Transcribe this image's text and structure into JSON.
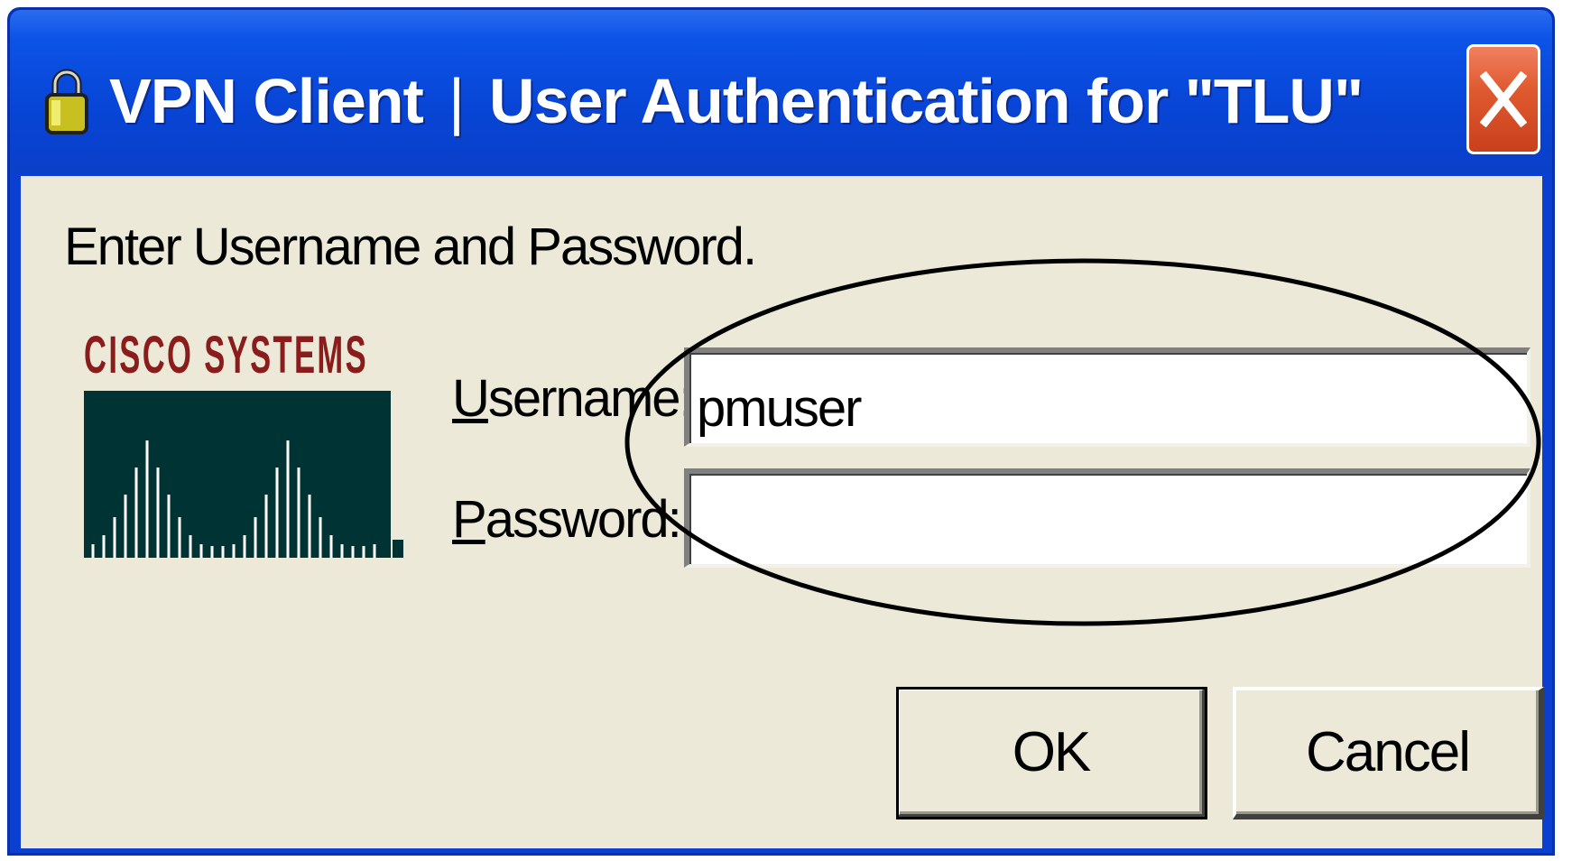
{
  "window": {
    "app_name": "VPN Client",
    "separator": "|",
    "dialog_title": "User Authentication for \"TLU\"",
    "close_symbol": "×"
  },
  "dialog": {
    "prompt": "Enter Username and Password.",
    "logo_text": "Cisco Systems",
    "username": {
      "label_accel": "U",
      "label_rest": "sername:",
      "value": "pmuser"
    },
    "password": {
      "label_accel": "P",
      "label_rest": "assword:",
      "value": ""
    },
    "ok_label": "OK",
    "cancel_label": "Cancel"
  },
  "colors": {
    "titlebar": "#0a47d8",
    "client_bg": "#ece9d8",
    "logo_red": "#8a1c1c",
    "logo_green": "#003030",
    "close_red": "#d8502a"
  }
}
